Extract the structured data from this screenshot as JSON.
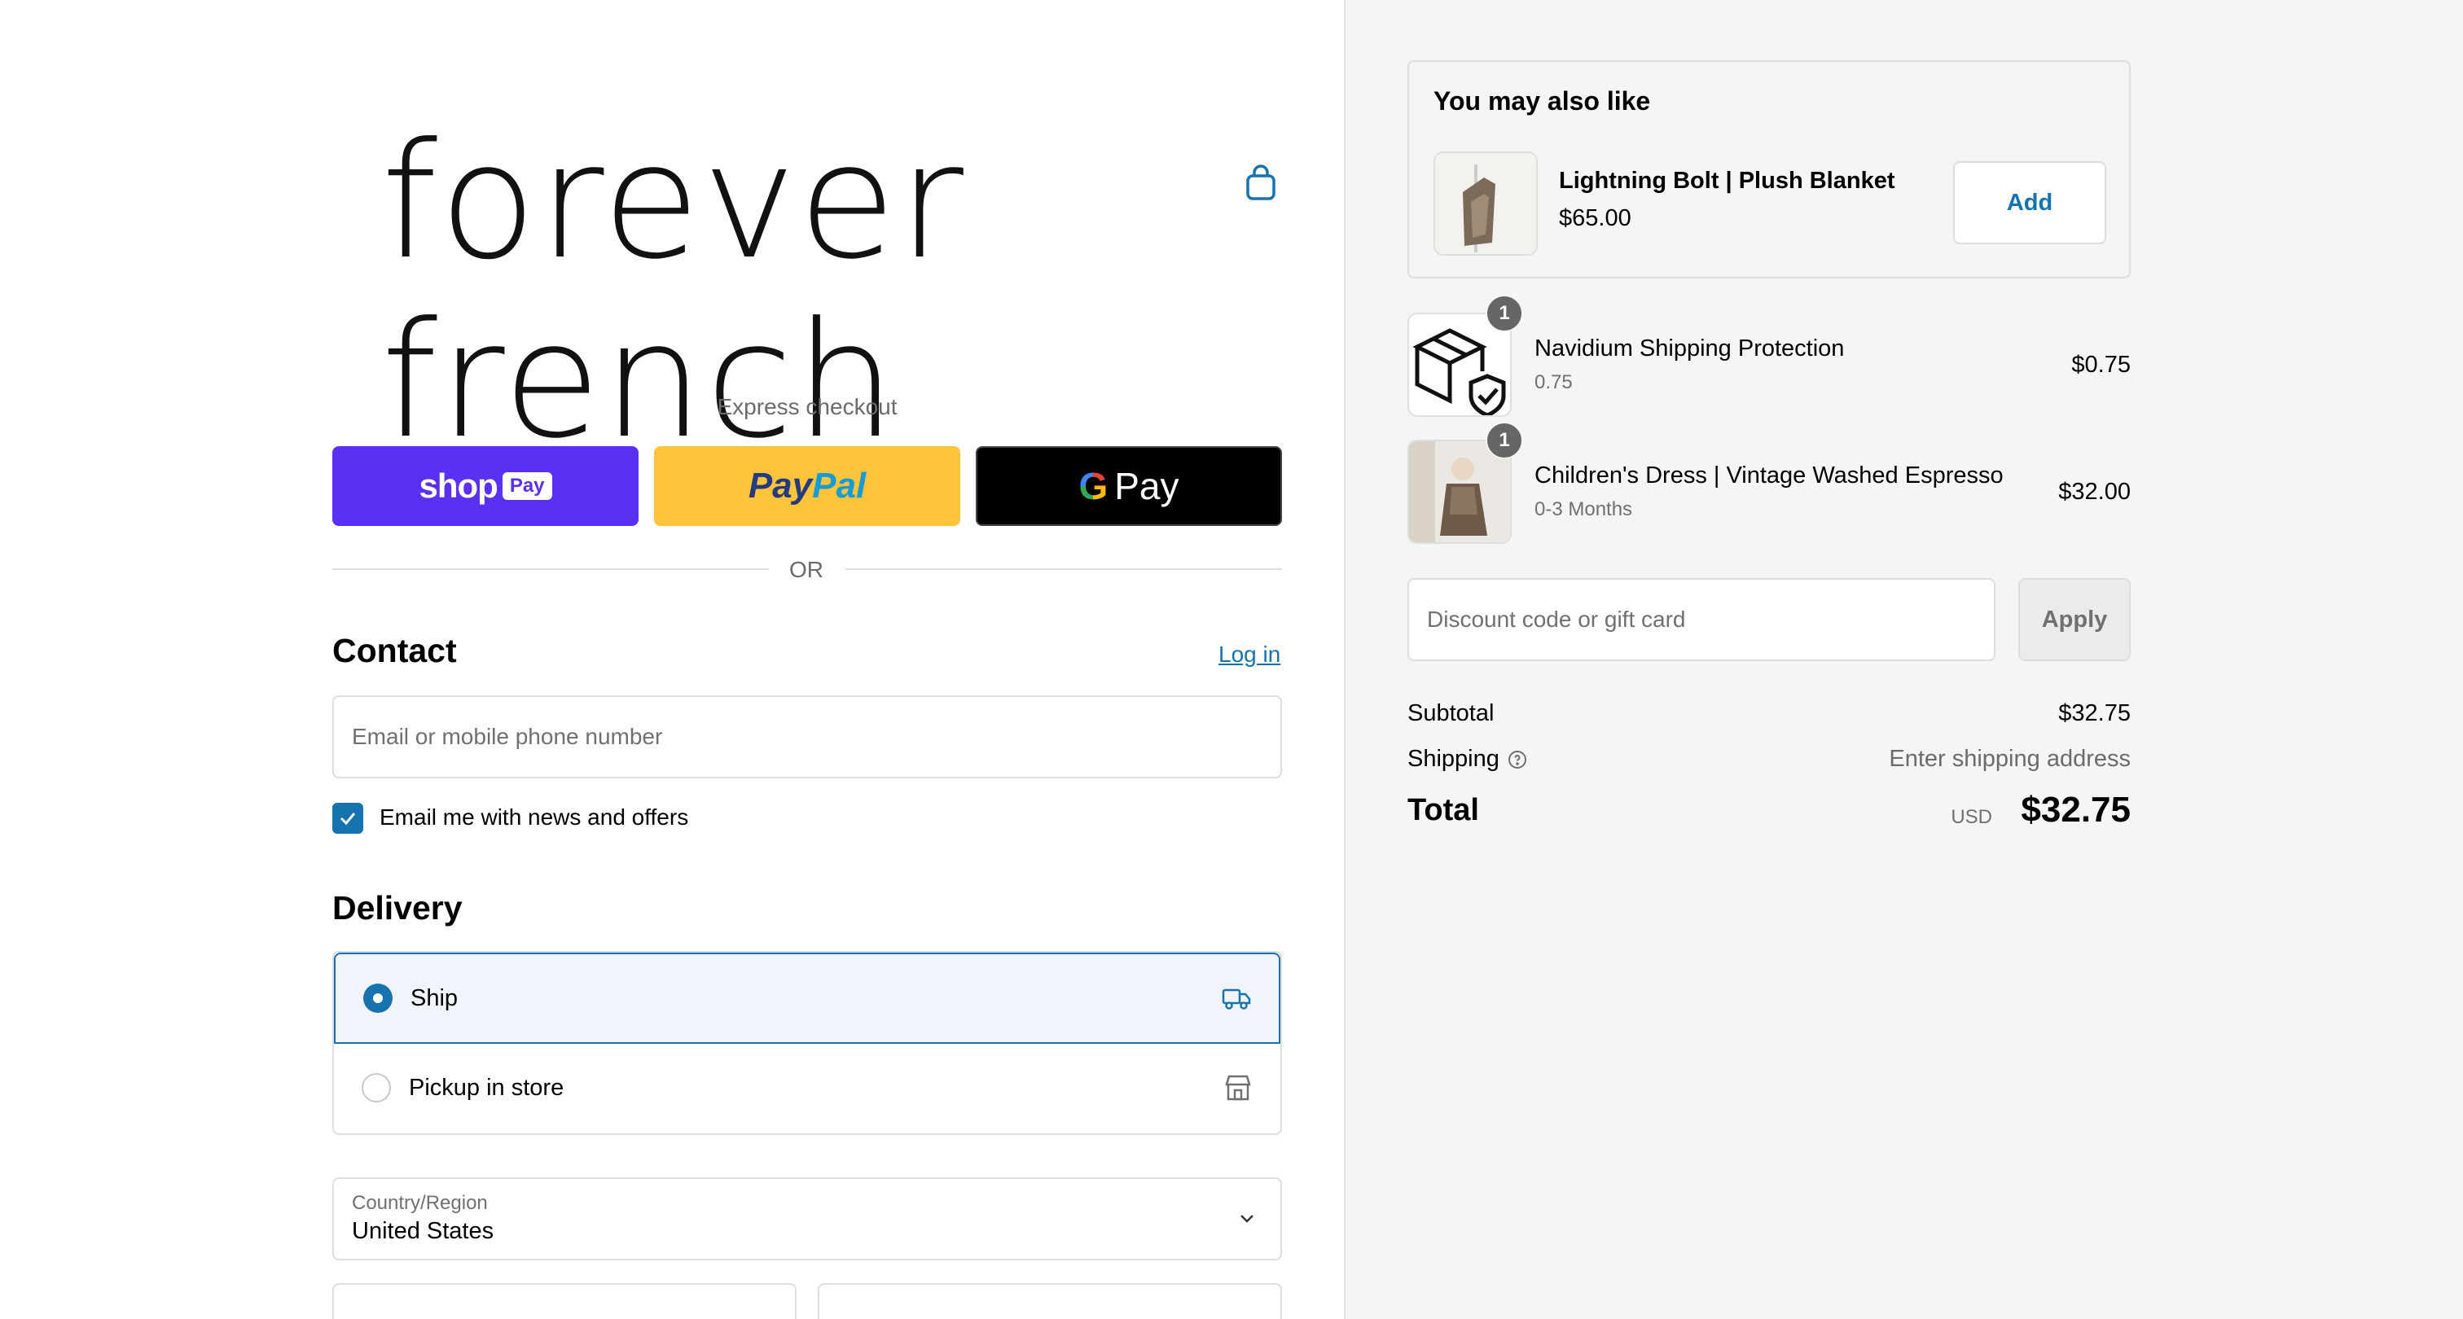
{
  "brand": {
    "logo_text": "forever french",
    "accent_color": "#1773b0"
  },
  "express": {
    "label": "Express checkout",
    "shop_pay": {
      "shop": "shop",
      "pay": "Pay"
    },
    "paypal": {
      "pay": "Pay",
      "pal": "Pal"
    },
    "gpay": {
      "g": "G",
      "pay": "Pay"
    },
    "or_label": "OR"
  },
  "contact": {
    "title": "Contact",
    "login_label": "Log in",
    "email_placeholder": "Email or mobile phone number",
    "newsletter_label": "Email me with news and offers",
    "newsletter_checked": true
  },
  "delivery": {
    "title": "Delivery",
    "options": [
      {
        "label": "Ship",
        "selected": true,
        "icon": "truck-icon"
      },
      {
        "label": "Pickup in store",
        "selected": false,
        "icon": "store-icon"
      }
    ],
    "country_label": "Country/Region",
    "country_value": "United States"
  },
  "upsell": {
    "title": "You may also like",
    "product_name": "Lightning Bolt | Plush Blanket",
    "product_price": "$65.00",
    "add_label": "Add"
  },
  "cart": {
    "items": [
      {
        "name": "Navidium Shipping Protection",
        "variant": "0.75",
        "price": "$0.75",
        "qty": "1",
        "icon": "package-shield-icon"
      },
      {
        "name": "Children's Dress | Vintage Washed Espresso",
        "variant": "0-3 Months",
        "price": "$32.00",
        "qty": "1",
        "icon": "dress-photo"
      }
    ]
  },
  "discount": {
    "placeholder": "Discount code or gift card",
    "apply_label": "Apply"
  },
  "summary": {
    "subtotal_label": "Subtotal",
    "subtotal_value": "$32.75",
    "shipping_label": "Shipping",
    "shipping_value": "Enter shipping address",
    "total_label": "Total",
    "currency": "USD",
    "total_value": "$32.75"
  }
}
